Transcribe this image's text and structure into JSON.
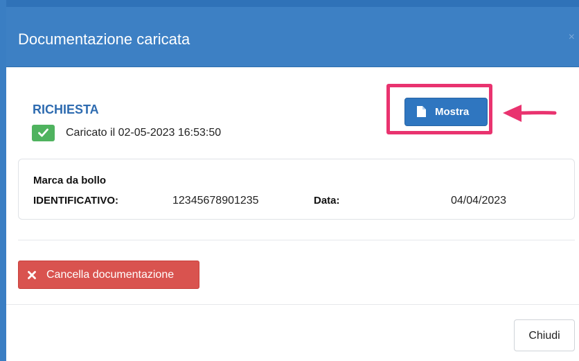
{
  "modal": {
    "title": "Documentazione caricata",
    "close_symbol": "×"
  },
  "document": {
    "label": "RICHIESTA",
    "upload_status": "Caricato il 02-05-2023 16:53:50",
    "status_icon": "check-icon",
    "status_color": "#4fb35f"
  },
  "buttons": {
    "show_label": "Mostra",
    "show_icon": "file-icon",
    "delete_label": "Cancella documentazione",
    "delete_icon": "times-icon",
    "close_label": "Chiudi"
  },
  "stamp": {
    "title": "Marca da bollo",
    "identifier_label": "IDENTIFICATIVO:",
    "identifier_value": "12345678901235",
    "date_label": "Data:",
    "date_value": "04/04/2023"
  },
  "annotation": {
    "highlight_color": "#e9336f",
    "arrow_color": "#e9336f"
  },
  "colors": {
    "header_bg": "#3d80c4",
    "primary_button": "#2f76c0",
    "danger_button": "#d9534f",
    "title_text": "#2e6bb0"
  }
}
